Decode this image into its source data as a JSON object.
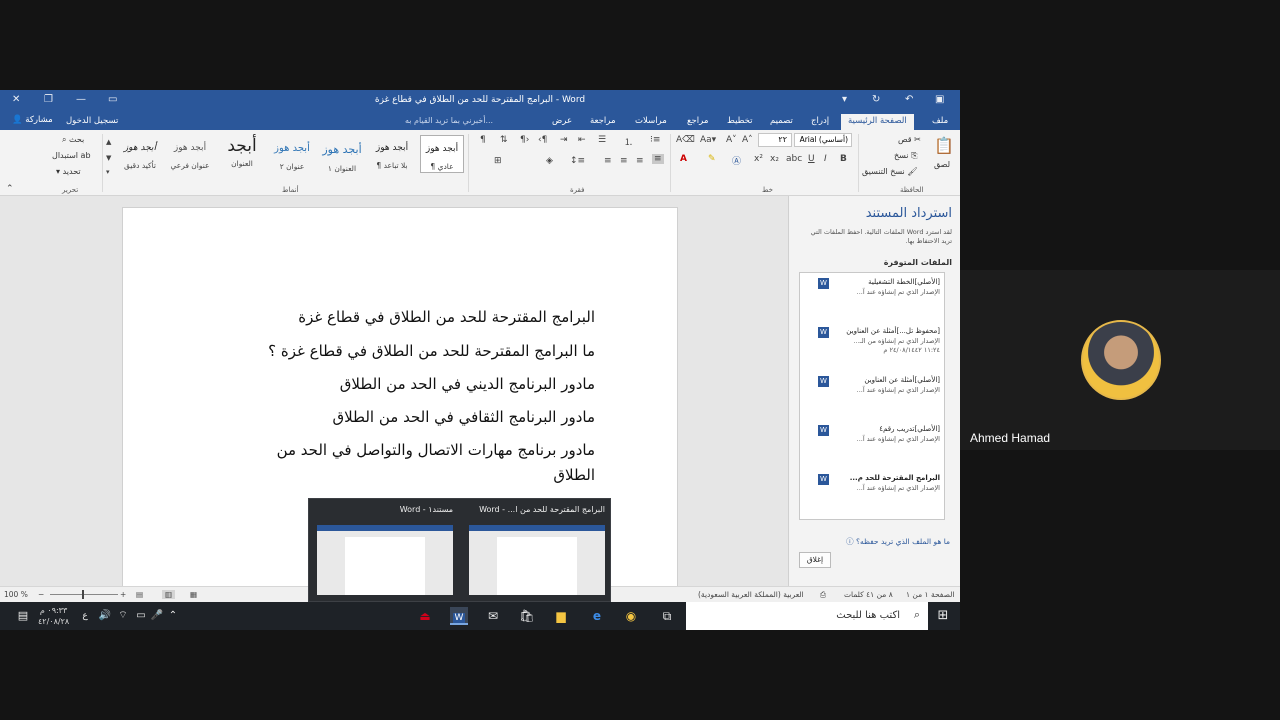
{
  "word": {
    "title": "البرامج المقترحة للحد من الطلاق في قطاع غزة - Word",
    "tabs": [
      "ملف",
      "الصفحة الرئيسية",
      "إدراج",
      "تصميم",
      "تخطيط",
      "مراجع",
      "مراسلات",
      "مراجعة",
      "عرض"
    ],
    "tell_me": "أخبرني بما تريد القيام به...",
    "sign_in": "تسجيل الدخول",
    "share": "مشاركة",
    "ribbon": {
      "clipboard": {
        "group": "الحافظة",
        "paste": "لصق",
        "cut": "قص",
        "copy": "نسخ",
        "format_painter": "نسخ التنسيق"
      },
      "font": {
        "group": "خط",
        "name": "Arial (أساسي)",
        "size": "٢٢"
      },
      "paragraph": {
        "group": "فقرة"
      },
      "styles": {
        "group": "أنماط",
        "items": [
          {
            "sample": "أبجد هوز",
            "name": "¶ عادي"
          },
          {
            "sample": "أبجد هوز",
            "name": "¶ بلا تباعد"
          },
          {
            "sample": "أبجد هوز",
            "name": "العنوان ١"
          },
          {
            "sample": "أبجد هوز",
            "name": "عنوان ٢"
          },
          {
            "sample": "أبجد",
            "name": "العنوان"
          },
          {
            "sample": "أبجد هوز",
            "name": "عنوان فرعي"
          },
          {
            "sample": "أبجد هوز",
            "name": "تأكيد دقيق"
          }
        ]
      },
      "editing": {
        "group": "تحرير",
        "find": "بحث",
        "replace": "استبدال",
        "select": "تحديد"
      }
    },
    "document": {
      "lines": [
        "البرامج المقترحة للحد من الطلاق في قطاع غزة",
        "ما البرامج المقترحة للحد من الطلاق في قطاع غزة ؟",
        "مادور البرنامج الديني في الحد من الطلاق",
        "مادور البرنامج الثقافي في الحد من الطلاق",
        "مادور برنامج مهارات الاتصال والتواصل في الحد من",
        "الطلاق"
      ]
    },
    "recovery": {
      "title": "استرداد المستند",
      "desc": "لقد استرد Word الملفات التالية. احفظ الملفات التي تريد الاحتفاظ بها.",
      "available": "الملفات المتوفرة",
      "files": [
        {
          "name": "[الأصلي]الخطة التشغيلية",
          "line2": "الإصدار الذي تم إنشاؤه عند آ...",
          "line3": ""
        },
        {
          "name": "[محفوظ تل...]أمثلة عن العناوين",
          "line2": "الإصدار الذي تم إنشاؤه من الـ...",
          "line3": "١١:٢٤ ٢٤/٠٨/١٤٤٢ م"
        },
        {
          "name": "[الأصلي]أمثلة عن العناوين",
          "line2": "الإصدار الذي تم إنشاؤه عند آ...",
          "line3": ""
        },
        {
          "name": "[الأصلي]تدريب رقم٤",
          "line2": "الإصدار الذي تم إنشاؤه عند آ...",
          "line3": ""
        },
        {
          "name": "البرامج المقترحة للحد م...",
          "line2": "الإصدار الذي تم إنشاؤه عند آ...",
          "line3": ""
        }
      ],
      "question": "ما هو الملف الذي تريد حفظه؟",
      "close": "إغلاق"
    },
    "status": {
      "page": "الصفحة ١ من ١",
      "words": "٨ من ٤١ كلمات",
      "language": "العربية (المملكة العربية السعودية)",
      "zoom": "100 %"
    }
  },
  "taskbar": {
    "search_placeholder": "اكتب هنا للبحث",
    "time": "٠٩:٣٣ م",
    "date": "٤٢/٠٨/٢٨",
    "previews": [
      {
        "title": "البرامج المقترحة للحد من ا... - Word"
      },
      {
        "title": "مستند١ - Word"
      }
    ]
  },
  "participant": {
    "name": "Ahmed Hamad"
  }
}
